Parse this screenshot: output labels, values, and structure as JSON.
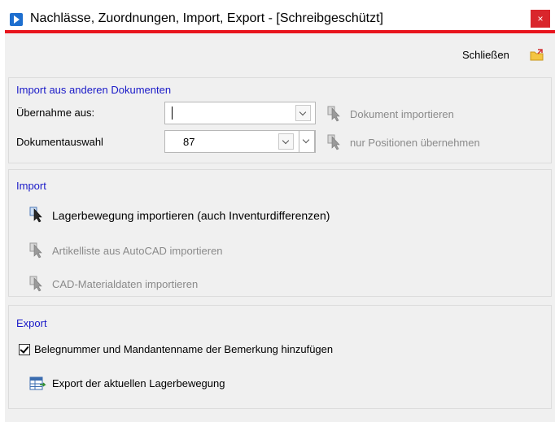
{
  "window": {
    "title": "Nachlässe, Zuordnungen, Import, Export - [Schreibgeschützt]",
    "close_glyph": "×",
    "close_link": "Schließen"
  },
  "import_docs": {
    "title": "Import aus anderen Dokumenten",
    "source_label": "Übernahme aus:",
    "source_value": "",
    "doc_label": "Dokumentauswahl",
    "doc_value": "87",
    "import_doc_label": "Dokument importieren",
    "positions_label": "nur Positionen übernehmen"
  },
  "import": {
    "title": "Import",
    "items": [
      {
        "label": "Lagerbewegung importieren (auch Inventurdifferenzen)",
        "enabled": true
      },
      {
        "label": "Artikelliste aus AutoCAD importieren",
        "enabled": false
      },
      {
        "label": "CAD-Materialdaten importieren",
        "enabled": false
      }
    ]
  },
  "export": {
    "title": "Export",
    "checkbox_label": "Belegnummer und Mandantenname der Bemerkung hinzufügen",
    "checkbox_checked": true,
    "action_label": "Export der aktuellen Lagerbewegung"
  }
}
